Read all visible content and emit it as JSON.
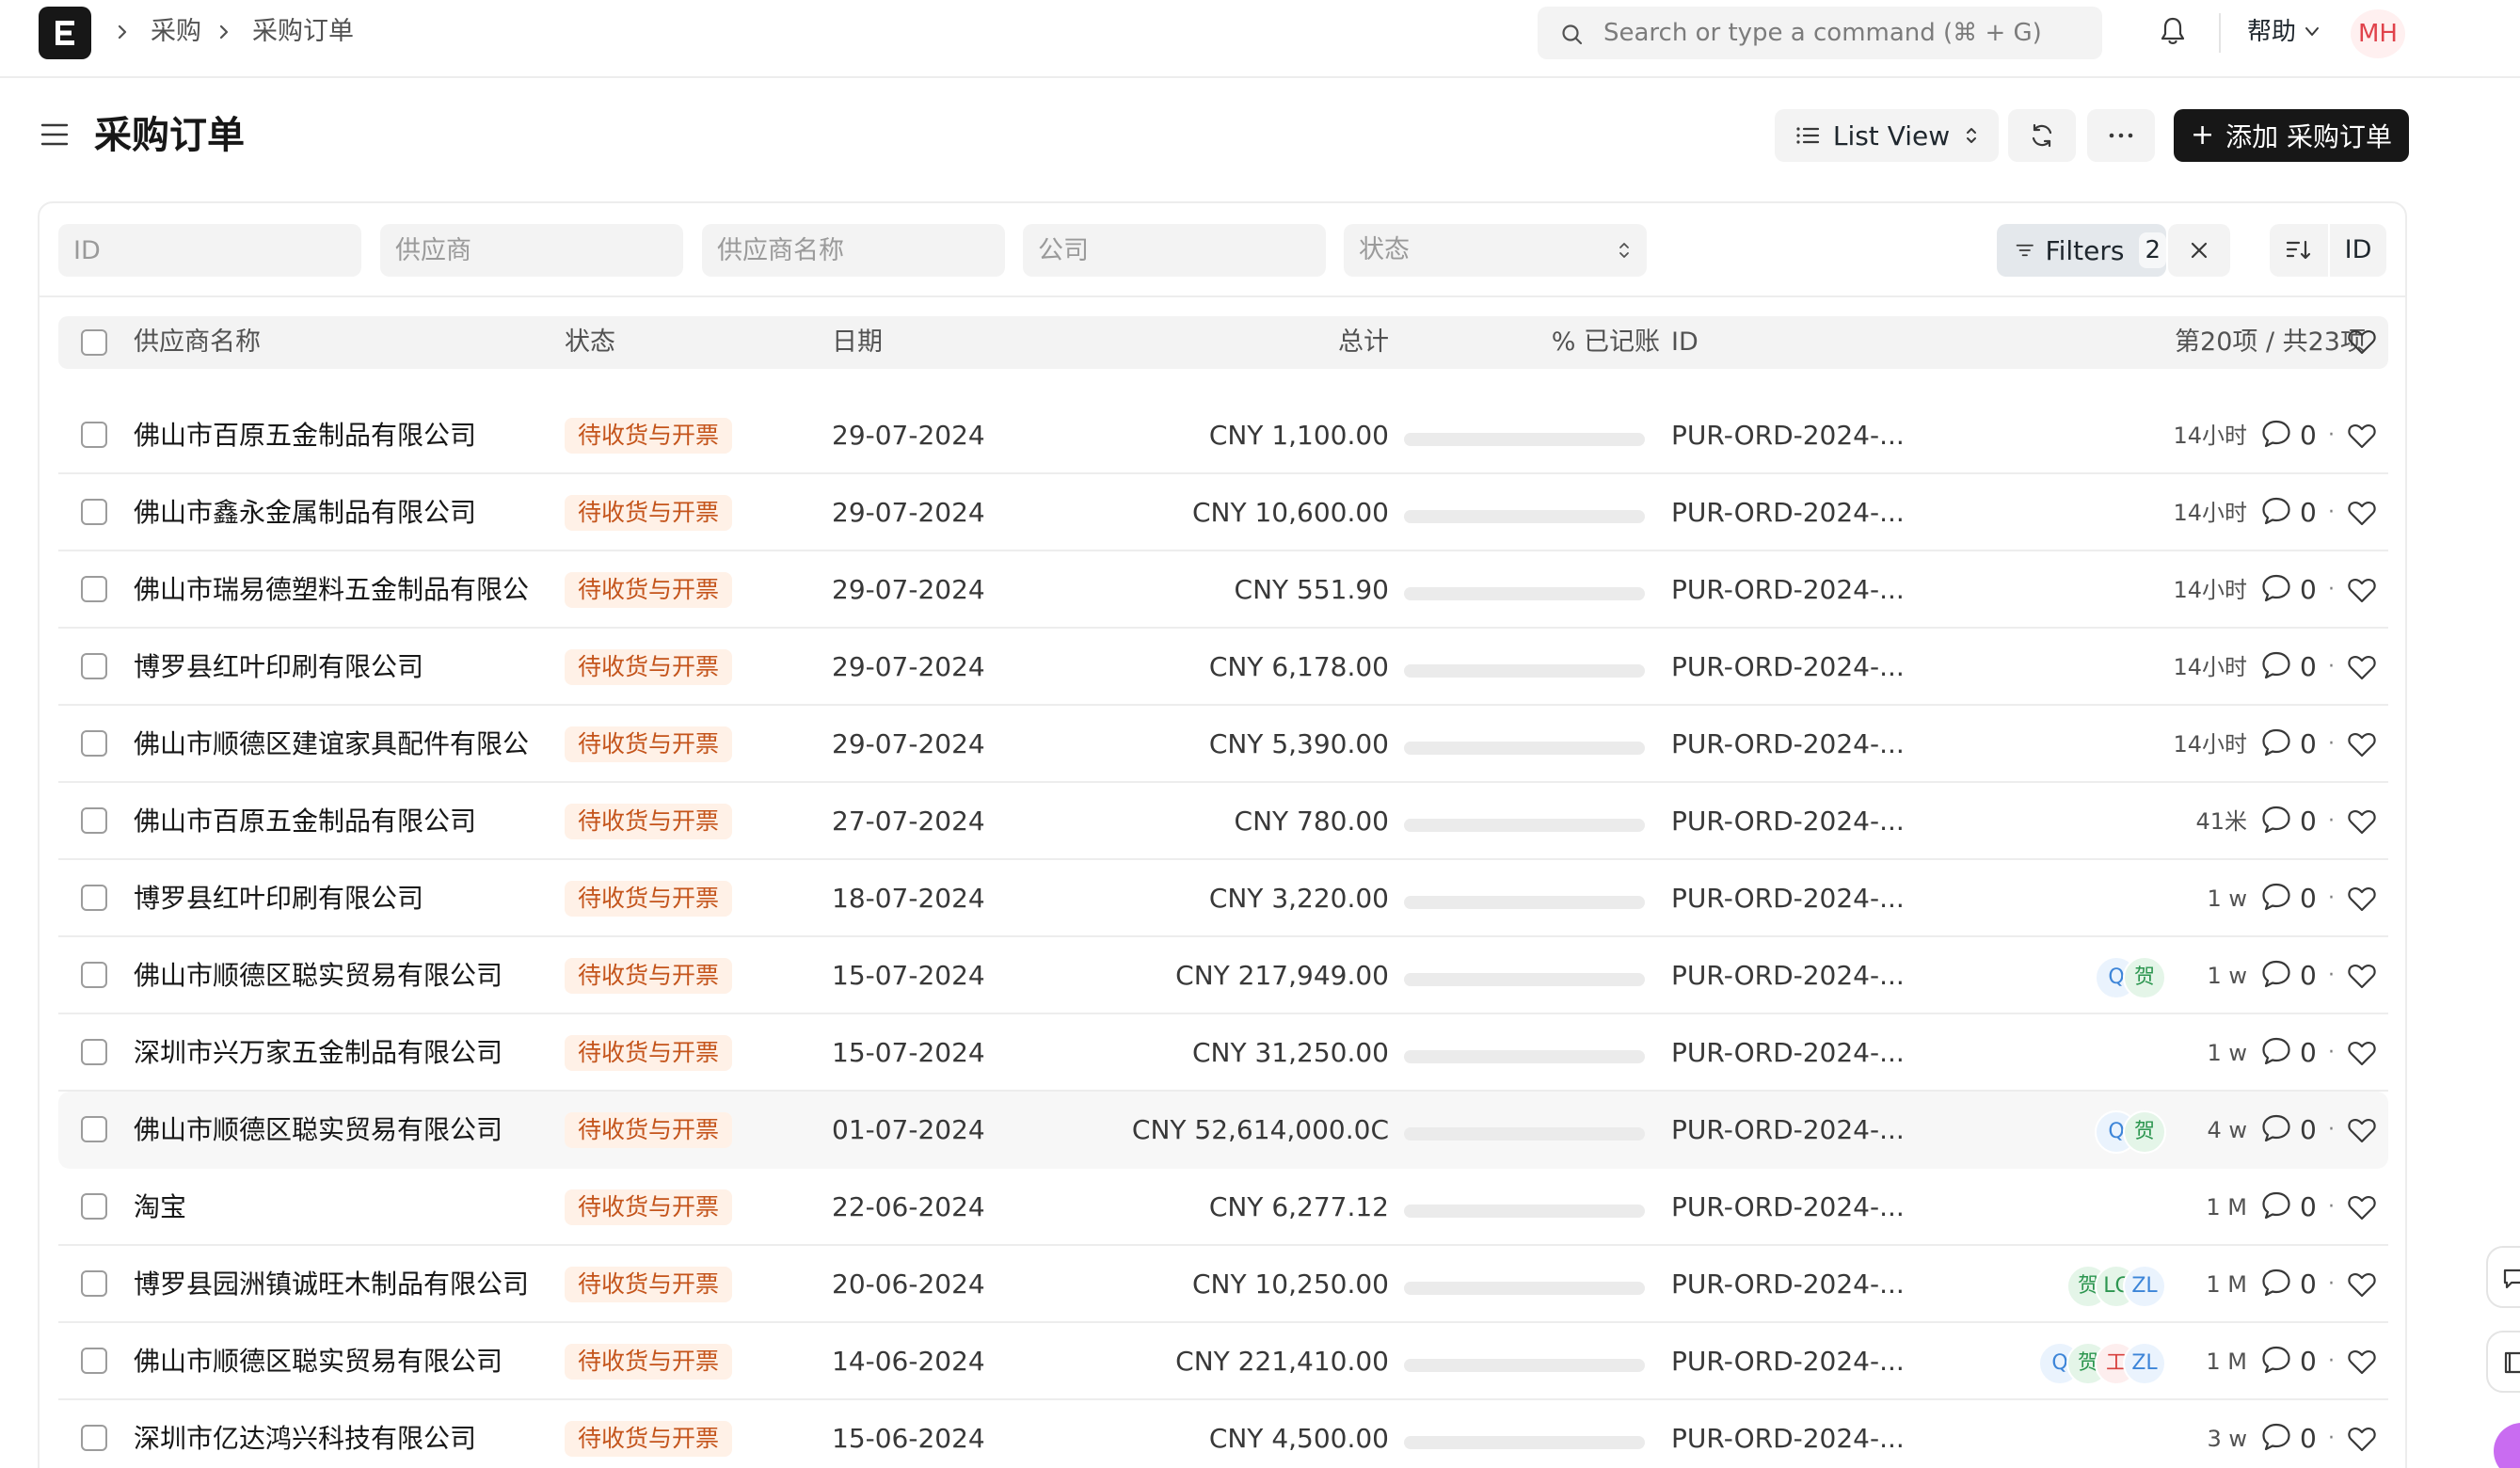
{
  "breadcrumb": [
    "采购",
    "采购订单"
  ],
  "search": {
    "placeholder": "Search or type a command (⌘ + G)"
  },
  "nav": {
    "help_label": "帮助",
    "user_initials": "MH"
  },
  "page": {
    "title": "采购订单"
  },
  "toolbar": {
    "view_label": "List View",
    "add_label": "添加 采购订单"
  },
  "filters": {
    "id_placeholder": "ID",
    "supplier_placeholder": "供应商",
    "supplier_name_placeholder": "供应商名称",
    "company_placeholder": "公司",
    "status_placeholder": "状态",
    "filters_label": "Filters",
    "filters_count": "2",
    "sort_field": "ID"
  },
  "list": {
    "columns": {
      "supplier_name": "供应商名称",
      "status": "状态",
      "date": "日期",
      "total": "总计",
      "billed": "% 已记账",
      "id": "ID",
      "count": "第20项 / 共23项"
    },
    "rows": [
      {
        "supplier": "佛山市百原五金制品有限公司",
        "status": "待收货与开票",
        "date": "29-07-2024",
        "total": "CNY 1,100.00",
        "billed_pct": 0,
        "id": "PUR-ORD-2024-...",
        "modified": "14小时",
        "comments": "0",
        "assignees": []
      },
      {
        "supplier": "佛山市鑫永金属制品有限公司",
        "status": "待收货与开票",
        "date": "29-07-2024",
        "total": "CNY 10,600.00",
        "billed_pct": 0,
        "id": "PUR-ORD-2024-...",
        "modified": "14小时",
        "comments": "0",
        "assignees": []
      },
      {
        "supplier": "佛山市瑞易德塑料五金制品有限公",
        "status": "待收货与开票",
        "date": "29-07-2024",
        "total": "CNY 551.90",
        "billed_pct": 0,
        "id": "PUR-ORD-2024-...",
        "modified": "14小时",
        "comments": "0",
        "assignees": []
      },
      {
        "supplier": "博罗县红叶印刷有限公司",
        "status": "待收货与开票",
        "date": "29-07-2024",
        "total": "CNY 6,178.00",
        "billed_pct": 0,
        "id": "PUR-ORD-2024-...",
        "modified": "14小时",
        "comments": "0",
        "assignees": []
      },
      {
        "supplier": "佛山市顺德区建谊家具配件有限公",
        "status": "待收货与开票",
        "date": "29-07-2024",
        "total": "CNY 5,390.00",
        "billed_pct": 0,
        "id": "PUR-ORD-2024-...",
        "modified": "14小时",
        "comments": "0",
        "assignees": []
      },
      {
        "supplier": "佛山市百原五金制品有限公司",
        "status": "待收货与开票",
        "date": "27-07-2024",
        "total": "CNY 780.00",
        "billed_pct": 0,
        "id": "PUR-ORD-2024-...",
        "modified": "41米",
        "comments": "0",
        "assignees": []
      },
      {
        "supplier": "博罗县红叶印刷有限公司",
        "status": "待收货与开票",
        "date": "18-07-2024",
        "total": "CNY 3,220.00",
        "billed_pct": 0,
        "id": "PUR-ORD-2024-...",
        "modified": "1 w",
        "comments": "0",
        "assignees": []
      },
      {
        "supplier": "佛山市顺德区聪实贸易有限公司",
        "status": "待收货与开票",
        "date": "15-07-2024",
        "total": "CNY 217,949.00",
        "billed_pct": 0,
        "id": "PUR-ORD-2024-...",
        "modified": "1 w",
        "comments": "0",
        "assignees": [
          {
            "text": "Q",
            "color": "blue"
          },
          {
            "text": "贺",
            "color": "green"
          }
        ]
      },
      {
        "supplier": "深圳市兴万家五金制品有限公司",
        "status": "待收货与开票",
        "date": "15-07-2024",
        "total": "CNY 31,250.00",
        "billed_pct": 0,
        "id": "PUR-ORD-2024-...",
        "modified": "1 w",
        "comments": "0",
        "assignees": []
      },
      {
        "supplier": "佛山市顺德区聪实贸易有限公司",
        "status": "待收货与开票",
        "date": "01-07-2024",
        "total": "CNY 52,614,000.0C",
        "billed_pct": 0,
        "id": "PUR-ORD-2024-...",
        "modified": "4 w",
        "comments": "0",
        "assignees": [
          {
            "text": "Q",
            "color": "blue"
          },
          {
            "text": "贺",
            "color": "green"
          }
        ]
      },
      {
        "supplier": "淘宝",
        "status": "待收货与开票",
        "date": "22-06-2024",
        "total": "CNY 6,277.12",
        "billed_pct": 0,
        "id": "PUR-ORD-2024-...",
        "modified": "1 M",
        "comments": "0",
        "assignees": []
      },
      {
        "supplier": "博罗县园洲镇诚旺木制品有限公司",
        "status": "待收货与开票",
        "date": "20-06-2024",
        "total": "CNY 10,250.00",
        "billed_pct": 0,
        "id": "PUR-ORD-2024-...",
        "modified": "1 M",
        "comments": "0",
        "assignees": [
          {
            "text": "贺",
            "color": "green"
          },
          {
            "text": "LC",
            "color": "green"
          },
          {
            "text": "ZL",
            "color": "blue"
          }
        ]
      },
      {
        "supplier": "佛山市顺德区聪实贸易有限公司",
        "status": "待收货与开票",
        "date": "14-06-2024",
        "total": "CNY 221,410.00",
        "billed_pct": 0,
        "id": "PUR-ORD-2024-...",
        "modified": "1 M",
        "comments": "0",
        "assignees": [
          {
            "text": "Q",
            "color": "blue"
          },
          {
            "text": "贺",
            "color": "green"
          },
          {
            "text": "工",
            "color": "red"
          },
          {
            "text": "ZL",
            "color": "blue"
          }
        ]
      },
      {
        "supplier": "深圳市亿达鸿兴科技有限公司",
        "status": "待收货与开票",
        "date": "15-06-2024",
        "total": "CNY 4,500.00",
        "billed_pct": 0,
        "id": "PUR-ORD-2024-...",
        "modified": "3 w",
        "comments": "0",
        "assignees": []
      }
    ]
  },
  "colors": {
    "status_bg": "#fff1e7",
    "status_text": "#c4541b",
    "primary_button": "#171717",
    "avatar_text": "#e0424b"
  },
  "icons": [
    "logo-e-icon",
    "chevron-right-icon",
    "search-icon",
    "bell-icon",
    "chevron-down-icon",
    "hamburger-icon",
    "list-icon",
    "refresh-icon",
    "more-icon",
    "plus-icon",
    "filter-icon",
    "close-icon",
    "sort-icon",
    "comment-icon",
    "heart-icon"
  ]
}
